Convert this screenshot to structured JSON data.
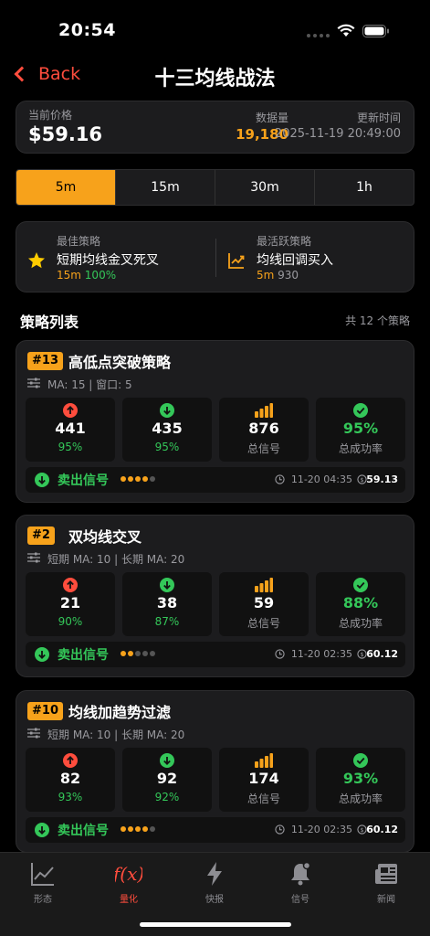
{
  "status": {
    "time": "20:54"
  },
  "nav": {
    "back_label": "Back",
    "title": "十三均线战法"
  },
  "price_card": {
    "price_label": "当前价格",
    "price": "$59.16",
    "count_label": "数据量",
    "count": "19,180",
    "update_label": "更新时间",
    "update_time": "2025-11-19 20:49:00"
  },
  "timeframes": [
    {
      "label": "5m",
      "active": true
    },
    {
      "label": "15m",
      "active": false
    },
    {
      "label": "30m",
      "active": false
    },
    {
      "label": "1h",
      "active": false
    }
  ],
  "best": {
    "best_label": "最佳策略",
    "best_name": "短期均线金叉死叉",
    "best_tf": "15m",
    "best_rate": "100%",
    "active_label": "最活跃策略",
    "active_name": "均线回调买入",
    "active_tf": "5m",
    "active_count": "930"
  },
  "list": {
    "title": "策略列表",
    "count": "共 12 个策略"
  },
  "cards": [
    {
      "rank": "#13",
      "name": "高低点突破策略",
      "params": "MA: 15 | 窗口: 5",
      "buy": "441",
      "buy_rate": "95%",
      "sell": "435",
      "sell_rate": "95%",
      "total": "876",
      "total_label": "总信号",
      "success": "95%",
      "success_label": "总成功率",
      "signal": "卖出信号",
      "strength": 4,
      "time": "11-20 04:35",
      "price": "59.13"
    },
    {
      "rank": "#2",
      "name": "双均线交叉",
      "params": "短期 MA: 10 | 长期 MA: 20",
      "buy": "21",
      "buy_rate": "90%",
      "sell": "38",
      "sell_rate": "87%",
      "total": "59",
      "total_label": "总信号",
      "success": "88%",
      "success_label": "总成功率",
      "signal": "卖出信号",
      "strength": 2,
      "time": "11-20 02:35",
      "price": "60.12"
    },
    {
      "rank": "#10",
      "name": "均线加趋势过滤",
      "params": "短期 MA: 10 | 长期 MA: 20",
      "buy": "82",
      "buy_rate": "93%",
      "sell": "92",
      "sell_rate": "92%",
      "total": "174",
      "total_label": "总信号",
      "success": "93%",
      "success_label": "总成功率",
      "signal": "卖出信号",
      "strength": 4,
      "time": "11-20 02:35",
      "price": "60.12"
    }
  ],
  "tabbar": [
    {
      "label": "形态",
      "icon": "chart-line-icon",
      "active": false
    },
    {
      "label": "量化",
      "icon": "function-icon",
      "active": true
    },
    {
      "label": "快报",
      "icon": "lightning-icon",
      "active": false
    },
    {
      "label": "信号",
      "icon": "bell-icon",
      "active": false
    },
    {
      "label": "新闻",
      "icon": "newspaper-icon",
      "active": false
    }
  ],
  "colors": {
    "accent": "#f7a21b",
    "red": "#ff4d3d",
    "green": "#34c759"
  }
}
